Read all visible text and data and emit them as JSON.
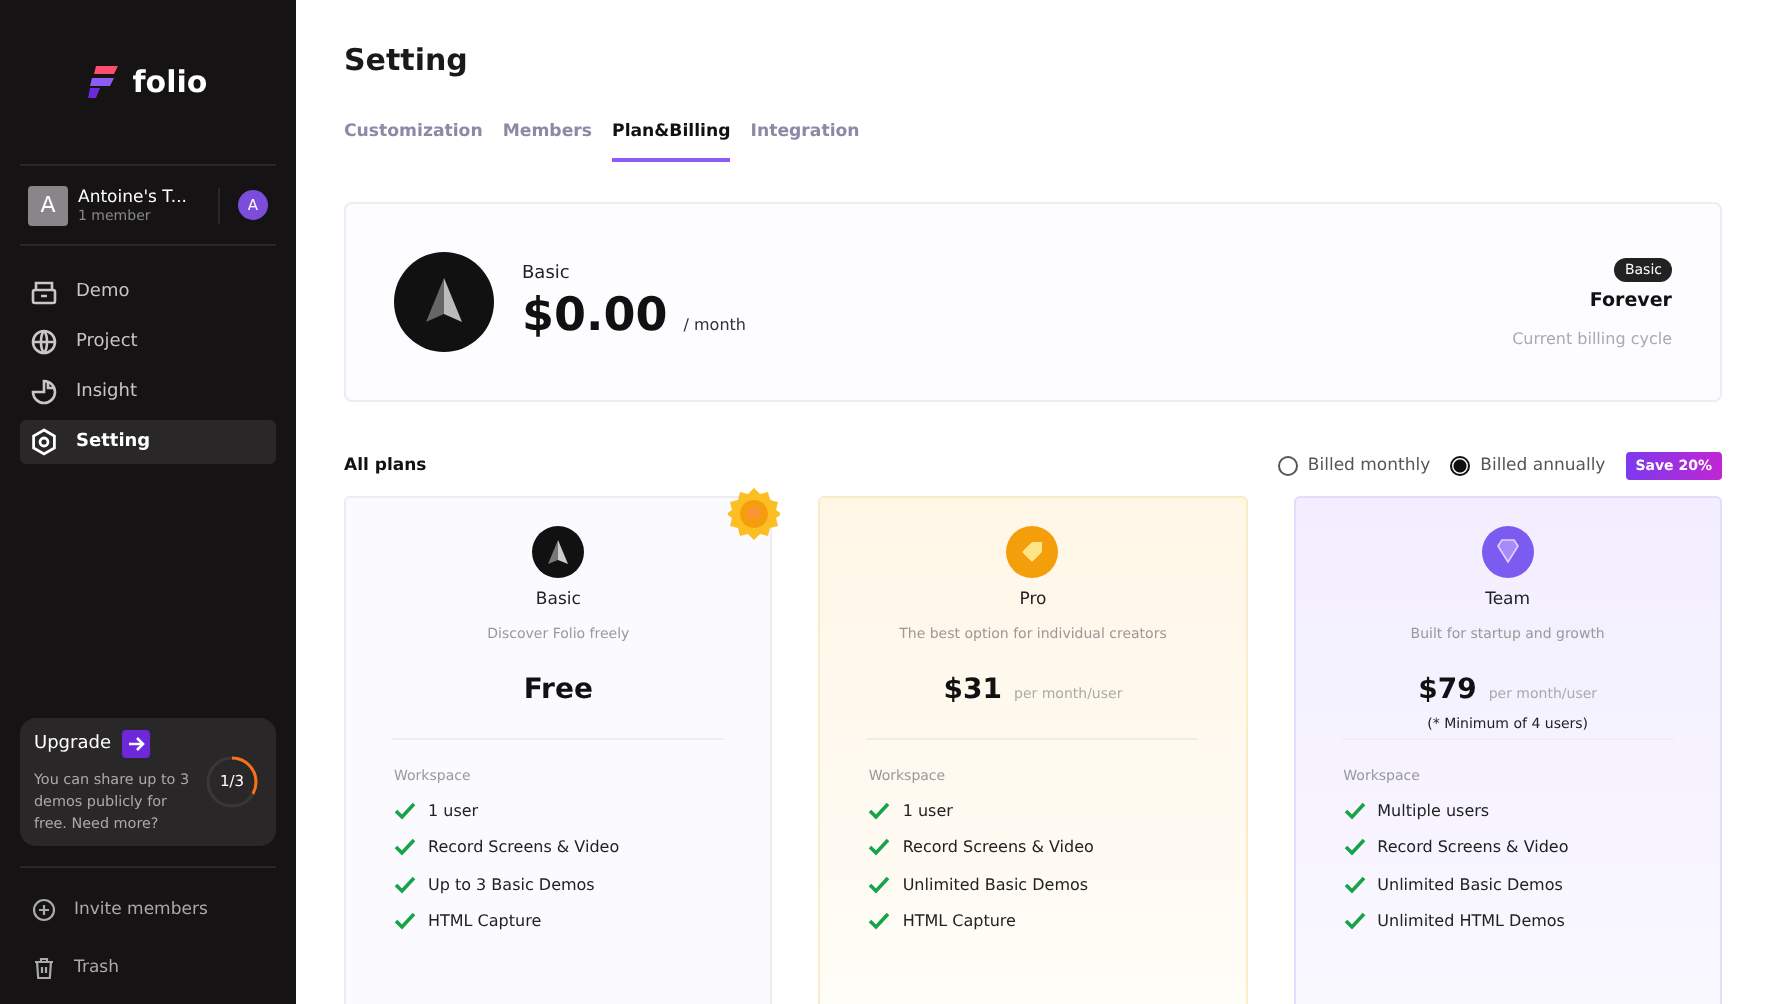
{
  "sidebar": {
    "logo": "folio",
    "workspace": {
      "name": "Antoine's T...",
      "members": "1 member",
      "initial": "A",
      "user_initial": "A"
    },
    "nav": [
      {
        "label": "Demo",
        "kind": "demo",
        "selected": false
      },
      {
        "label": "Project",
        "kind": "project",
        "selected": false
      },
      {
        "label": "Insight",
        "kind": "insight",
        "selected": false
      },
      {
        "label": "Setting",
        "kind": "setting",
        "selected": true
      }
    ],
    "upgrade": {
      "title": "Upgrade",
      "text": "You can share up to 3 demos publicly for free. Need more?",
      "progress": "1/3",
      "level": 0.33
    },
    "footer": [
      {
        "label": "Invite members",
        "kind": "invite"
      },
      {
        "label": "Trash",
        "kind": "trash"
      }
    ]
  },
  "title": "Setting",
  "tabs": [
    {
      "label": "Customization",
      "selected": false
    },
    {
      "label": "Members",
      "selected": false
    },
    {
      "label": "Plan&Billing",
      "selected": true
    },
    {
      "label": "Integration",
      "selected": false
    }
  ],
  "current_plan": {
    "name": "Basic",
    "price": "$0.00",
    "period": "/ month",
    "badge": "Basic",
    "duration": "Forever",
    "caption": "Current billing cycle"
  },
  "plans_header": {
    "title": "All plans",
    "billing": [
      {
        "label": "Billed monthly",
        "selected": false
      },
      {
        "label": "Billed annually",
        "selected": true
      }
    ],
    "save_badge": "Save 20%"
  },
  "plans": [
    {
      "kind": "basic",
      "current": true,
      "name": "Basic",
      "tagline": "Discover Folio freely",
      "price": "Free",
      "section": "Workspace",
      "features": [
        "1 user",
        "Record Screens & Video",
        "Up to 3 Basic Demos",
        "HTML Capture"
      ]
    },
    {
      "kind": "pro",
      "current": false,
      "name": "Pro",
      "tagline": "The best option for individual creators",
      "price": "$31",
      "unit": "per month/user",
      "section": "Workspace",
      "features": [
        "1 user",
        "Record Screens & Video",
        "Unlimited Basic Demos",
        "HTML Capture"
      ]
    },
    {
      "kind": "team",
      "current": false,
      "name": "Team",
      "tagline": "Built for startup and growth",
      "price": "$79",
      "unit": "per month/user",
      "note": "(* Minimum of 4 users)",
      "section": "Workspace",
      "features": [
        "Multiple users",
        "Record Screens & Video",
        "Unlimited Basic Demos",
        "Unlimited HTML Demos"
      ]
    }
  ]
}
